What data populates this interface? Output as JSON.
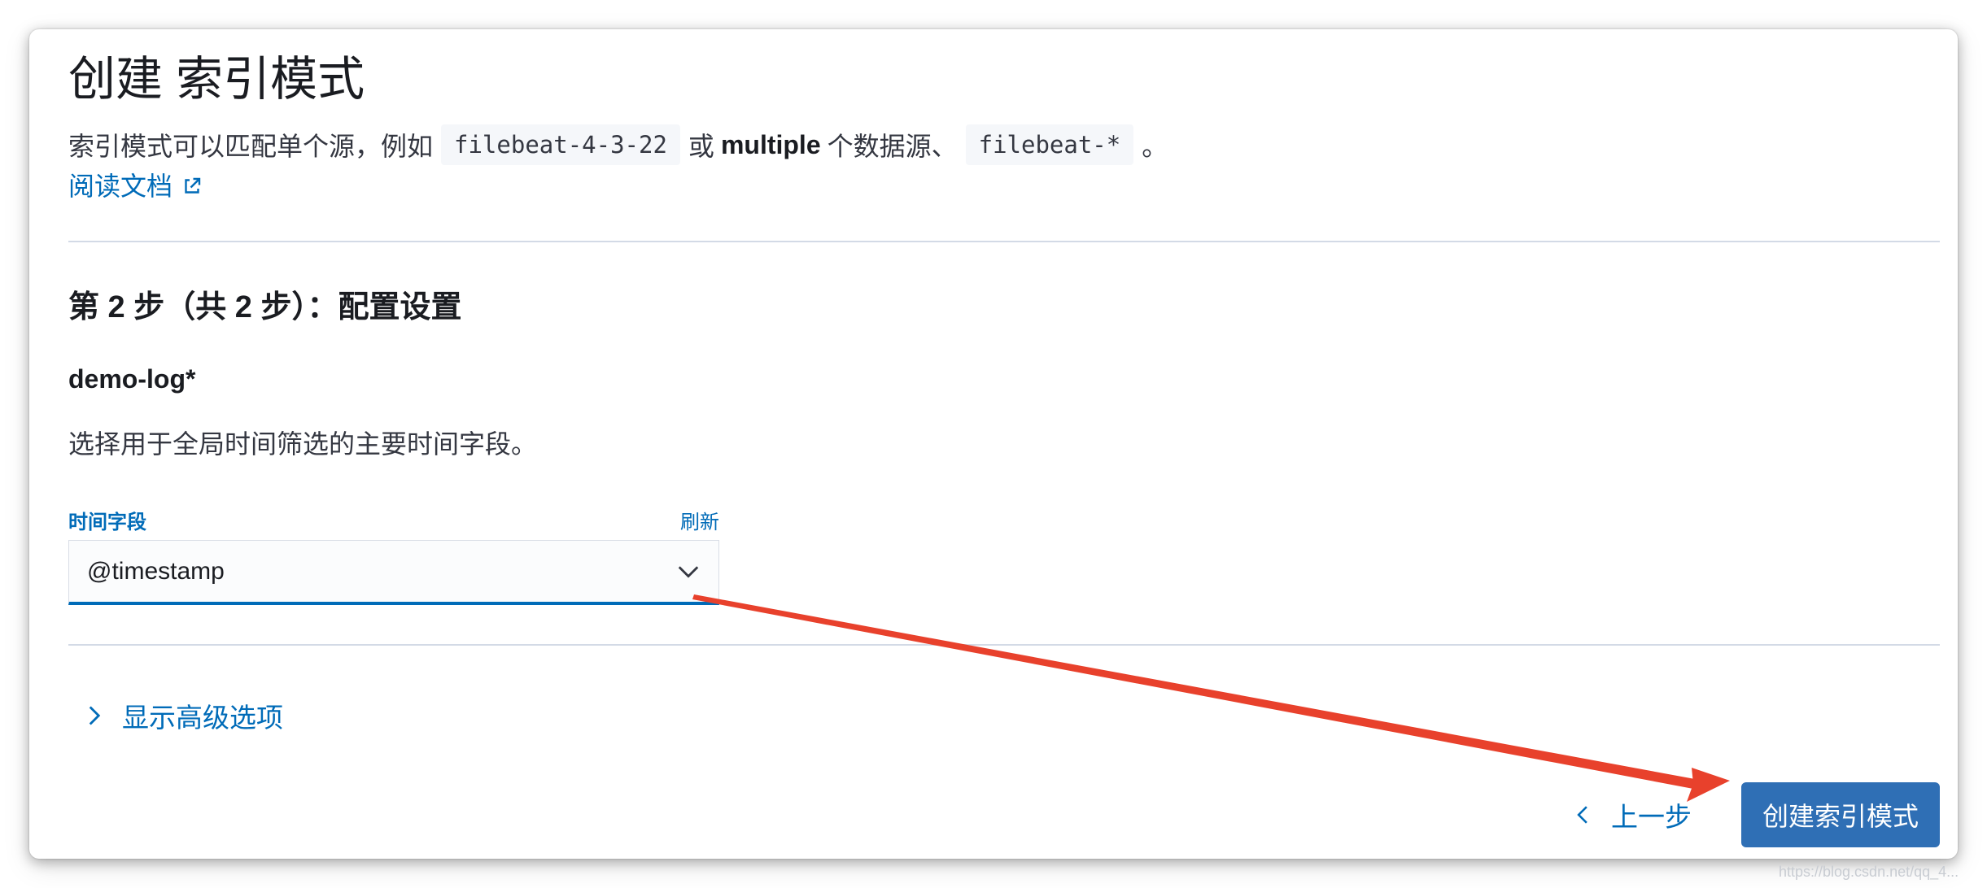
{
  "page": {
    "title": "创建 索引模式",
    "description": {
      "prefix": "索引模式可以匹配单个源，例如",
      "code_single": "filebeat-4-3-22",
      "or_word": "或",
      "multiple_word": "multiple",
      "middle": "个数据源、",
      "code_multiple": "filebeat-*",
      "suffix": "。"
    },
    "docs_link": "阅读文档",
    "docs_link_icon": "external-link-icon"
  },
  "step": {
    "title": "第 2 步（共 2 步）：配置设置",
    "index_pattern": "demo-log*",
    "help_text": "选择用于全局时间筛选的主要时间字段。"
  },
  "time_field": {
    "label": "时间字段",
    "refresh_label": "刷新",
    "selected_value": "@timestamp",
    "dropdown_icon": "chevron-down-icon"
  },
  "advanced": {
    "label": "显示高级选项",
    "icon": "chevron-right-icon"
  },
  "actions": {
    "back_label": "上一步",
    "back_icon": "chevron-left-icon",
    "create_label": "创建索引模式"
  },
  "annotation": {
    "type": "arrow",
    "color": "#e8412c"
  },
  "watermark": "https://blog.csdn.net/qq_4..."
}
